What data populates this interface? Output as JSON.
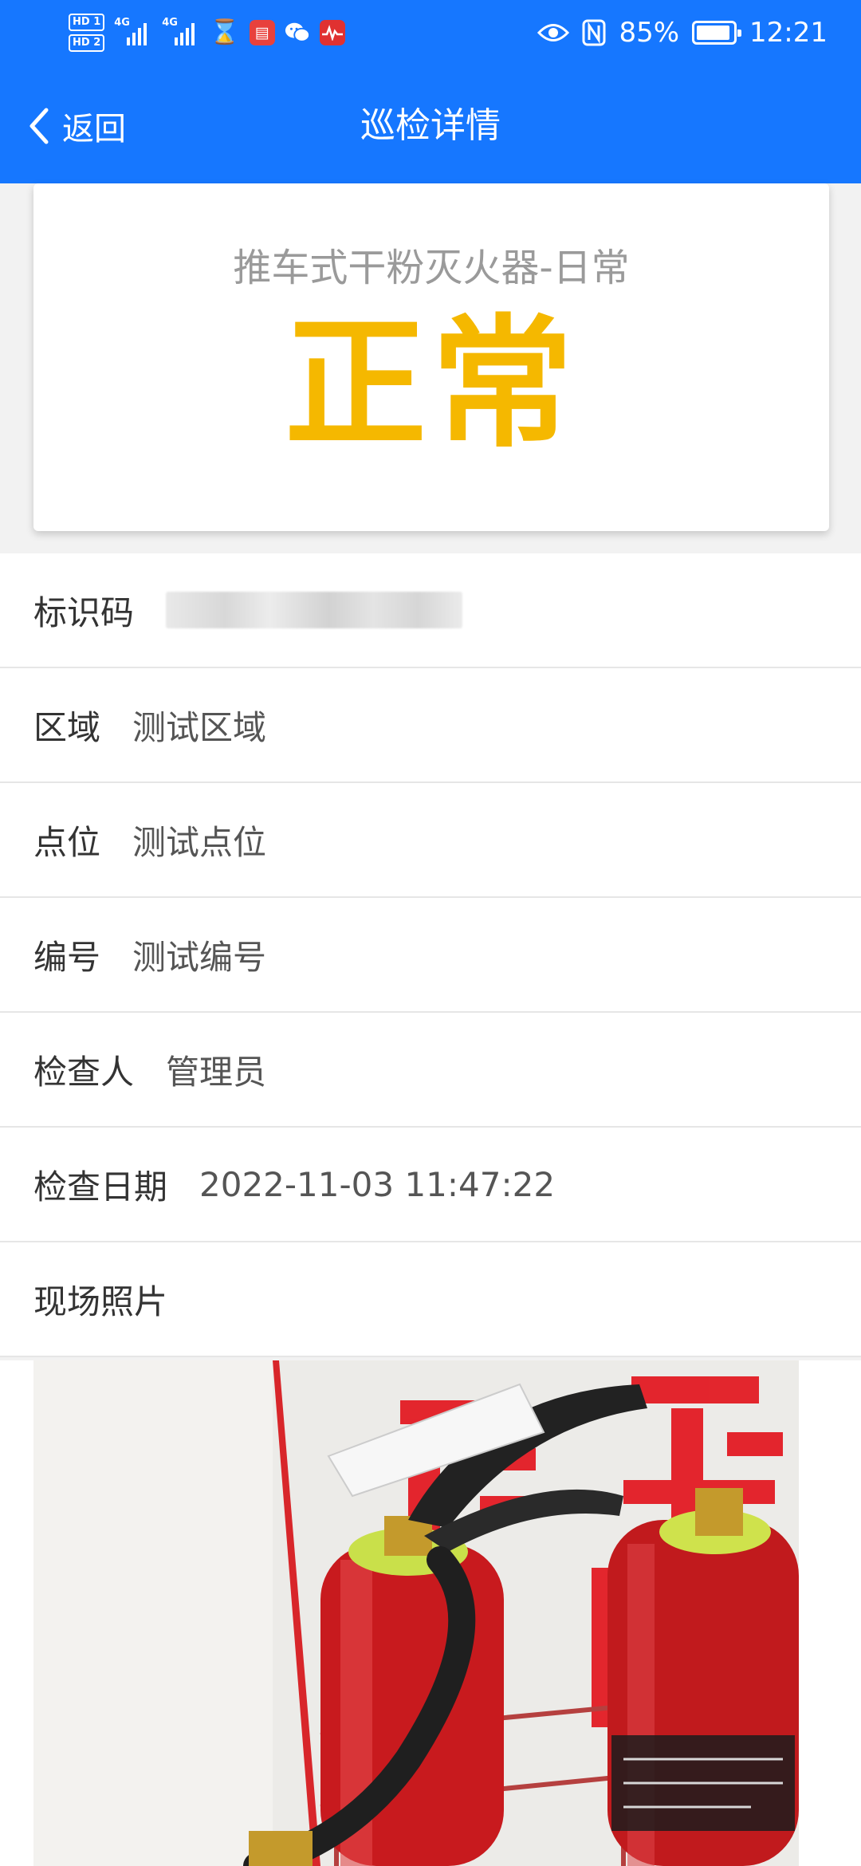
{
  "status_bar": {
    "sim1_label": "HD 1",
    "sim2_label": "HD 2",
    "network1_label": "4G",
    "network2_label": "4G",
    "battery": "85%",
    "battery_level": 0.85,
    "time": "12:21",
    "icons": [
      "hourglass-icon",
      "book-app-icon",
      "wechat-icon",
      "pulse-app-icon",
      "eye-icon",
      "nfc-icon",
      "battery-icon"
    ]
  },
  "nav": {
    "back_label": "返回",
    "title": "巡检详情"
  },
  "card": {
    "device_title": "推车式干粉灭火器-日常",
    "status": "正常",
    "status_color": "#f5b800"
  },
  "details": [
    {
      "label": "标识码",
      "value": ""
    },
    {
      "label": "区域",
      "value": "测试区域"
    },
    {
      "label": "点位",
      "value": "测试点位"
    },
    {
      "label": "编号",
      "value": "测试编号"
    },
    {
      "label": "检查人",
      "value": "管理员"
    },
    {
      "label": "检查日期",
      "value": "2022-11-03 11:47:22"
    },
    {
      "label": "现场照片",
      "value": ""
    }
  ],
  "colors": {
    "primary": "#1677ff",
    "status_yellow": "#f5b800"
  }
}
